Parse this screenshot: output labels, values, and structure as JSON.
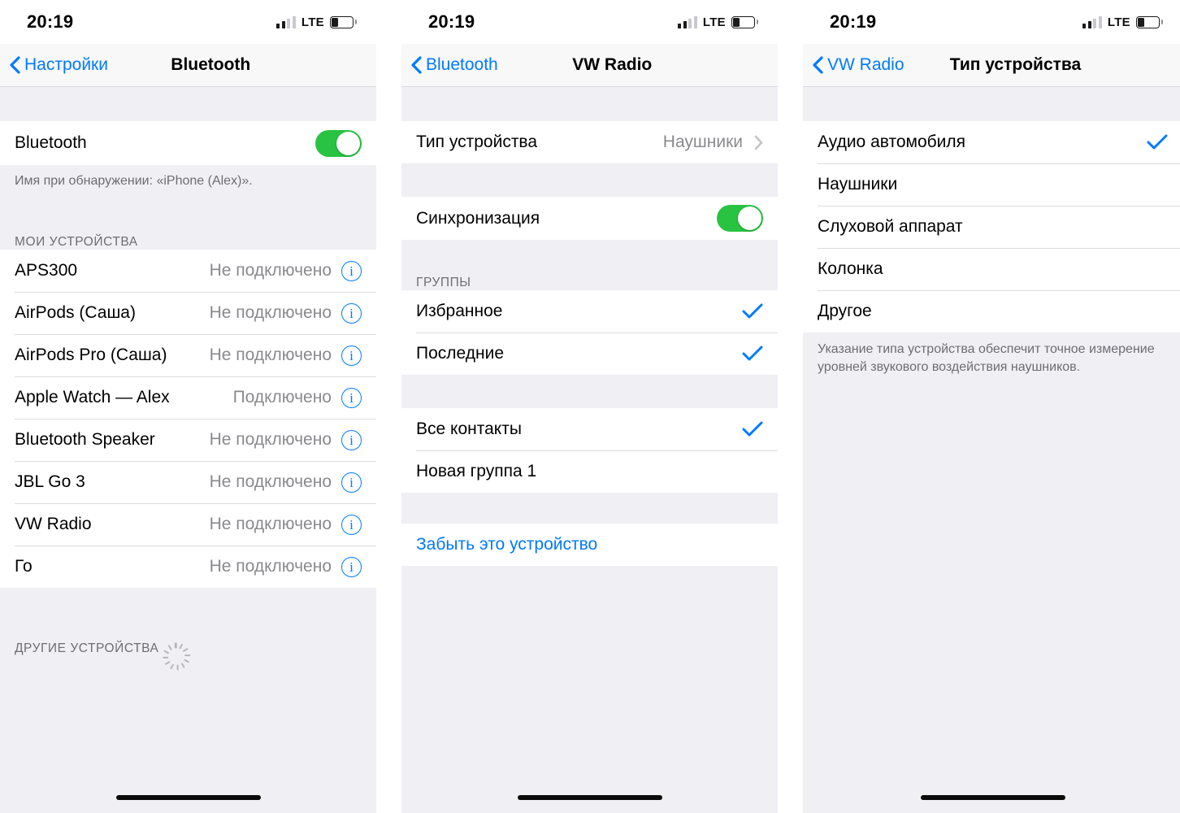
{
  "statusbar": {
    "time": "20:19",
    "carrier_label": "LTE",
    "signal_bars_active": 2,
    "signal_bars_total": 4,
    "battery_percent": 30
  },
  "colors": {
    "accent_blue": "#007AFF",
    "toggle_green": "#28C340",
    "group_background": "#EFEFF4",
    "row_background": "#FFFFFF",
    "secondary_text": "#8A8A8E",
    "header_text": "#6D6D72"
  },
  "panel_bluetooth": {
    "nav": {
      "back_label": "Настройки",
      "title": "Bluetooth"
    },
    "toggle_row": {
      "label": "Bluetooth",
      "state": "on"
    },
    "discovery_note": "Имя при обнаружении: «iPhone (Alex)».",
    "my_devices_header": "МОИ УСТРОЙСТВА",
    "devices": [
      {
        "name": "APS300",
        "status": "Не подключено"
      },
      {
        "name": "AirPods (Саша)",
        "status": "Не подключено"
      },
      {
        "name": "AirPods Pro (Саша)",
        "status": "Не подключено"
      },
      {
        "name": "Apple Watch — Alex",
        "status": "Подключено"
      },
      {
        "name": "Bluetooth Speaker",
        "status": "Не подключено"
      },
      {
        "name": "JBL Go 3",
        "status": "Не подключено"
      },
      {
        "name": "VW Radio",
        "status": "Не подключено"
      },
      {
        "name": "Го",
        "status": "Не подключено"
      }
    ],
    "other_devices_header": "ДРУГИЕ УСТРОЙСТВА"
  },
  "panel_vw_radio": {
    "nav": {
      "back_label": "Bluetooth",
      "title": "VW Radio"
    },
    "device_type_row": {
      "label": "Тип устройства",
      "value": "Наушники"
    },
    "sync_row": {
      "label": "Синхронизация",
      "state": "on"
    },
    "groups_header": "ГРУППЫ",
    "groups": [
      {
        "label": "Избранное",
        "checked": true
      },
      {
        "label": "Последние",
        "checked": true
      }
    ],
    "contact_groups": [
      {
        "label": "Все контакты",
        "checked": true
      },
      {
        "label": "Новая группа 1",
        "checked": false
      }
    ],
    "forget_device_label": "Забыть это устройство"
  },
  "panel_device_type": {
    "nav": {
      "back_label": "VW Radio",
      "title": "Тип устройства"
    },
    "options": [
      {
        "label": "Аудио автомобиля",
        "checked": true
      },
      {
        "label": "Наушники",
        "checked": false
      },
      {
        "label": "Слуховой аппарат",
        "checked": false
      },
      {
        "label": "Колонка",
        "checked": false
      },
      {
        "label": "Другое",
        "checked": false
      }
    ],
    "footnote": "Указание типа устройства обеспечит точное измерение уровней звукового воздействия наушников."
  }
}
